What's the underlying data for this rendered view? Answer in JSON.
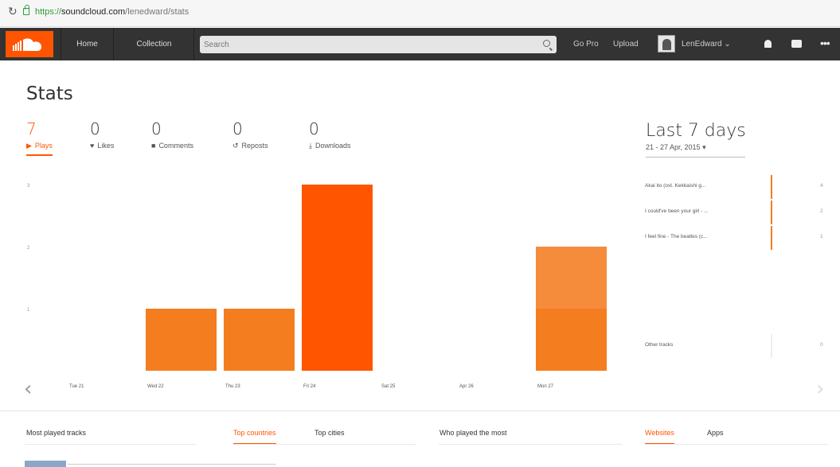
{
  "browser": {
    "url_scheme": "https://",
    "url_host": "soundcloud.com",
    "url_path": "/lenedward/stats"
  },
  "header": {
    "home": "Home",
    "collection": "Collection",
    "search_placeholder": "Search",
    "go_pro": "Go Pro",
    "upload": "Upload",
    "username": "LenEdward",
    "more": "•••",
    "accent": "#ff5500"
  },
  "page": {
    "title": "Stats"
  },
  "stats": [
    {
      "value": "7",
      "label": "Plays",
      "icon": "play-icon",
      "active": true
    },
    {
      "value": "0",
      "label": "Likes",
      "icon": "heart-icon"
    },
    {
      "value": "0",
      "label": "Comments",
      "icon": "comment-icon"
    },
    {
      "value": "0",
      "label": "Reposts",
      "icon": "repost-icon"
    },
    {
      "value": "0",
      "label": "Downloads",
      "icon": "download-icon"
    }
  ],
  "period": {
    "label": "Last 7 days",
    "range": "21 - 27 Apr, 2015"
  },
  "chart_data": {
    "type": "bar",
    "categories": [
      "Tue 21",
      "Wed 22",
      "Thu 23",
      "Fri 24",
      "Sat 25",
      "Apr 26",
      "Mon 27"
    ],
    "series": [
      {
        "values": [
          0,
          1,
          1,
          3,
          0,
          0,
          1
        ],
        "color": "#f47d20"
      },
      {
        "values": [
          0,
          0,
          0,
          0,
          0,
          0,
          1
        ],
        "color": "#f58c3c"
      }
    ],
    "stacked": true,
    "y_ticks": [
      "1",
      "2",
      "3"
    ],
    "ylim": [
      0,
      3
    ]
  },
  "tracks": [
    {
      "name": "Akai ito (ost. Kekkaishi g...",
      "count": "4"
    },
    {
      "name": "I could've been your girl - ...",
      "count": "2"
    },
    {
      "name": "I feel fine - The beatles (c...",
      "count": "1"
    },
    {
      "name": "Other tracks",
      "count": "0"
    }
  ],
  "bottom_tabs": {
    "most_played": "Most played tracks",
    "top_countries": "Top countries",
    "top_cities": "Top cities",
    "who_played": "Who played the most",
    "websites": "Websites",
    "apps": "Apps"
  }
}
